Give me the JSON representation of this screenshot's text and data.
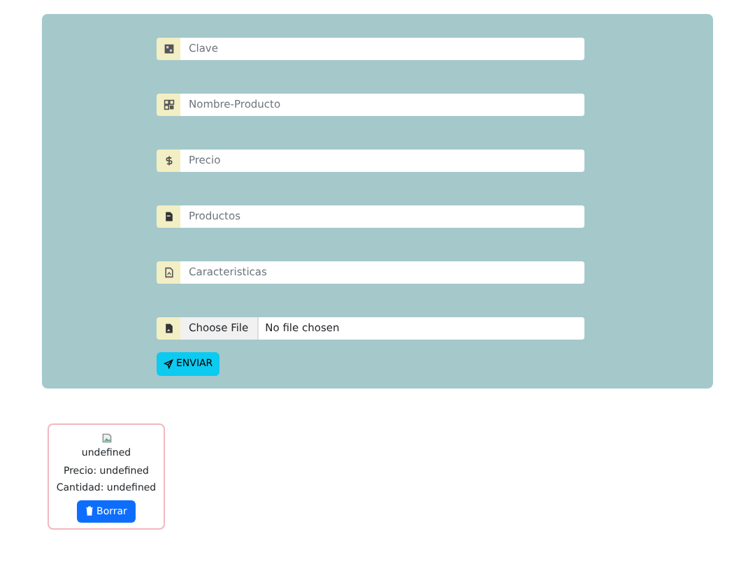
{
  "form": {
    "fields": [
      {
        "kind": "text",
        "placeholder": "Clave"
      },
      {
        "kind": "text",
        "placeholder": "Nombre-Producto"
      },
      {
        "kind": "text",
        "placeholder": "Precio"
      },
      {
        "kind": "text",
        "placeholder": "Productos"
      },
      {
        "kind": "text",
        "placeholder": "Caracteristicas"
      },
      {
        "kind": "file",
        "button": "Choose File",
        "value": "No file chosen"
      }
    ],
    "submit": "ENVIAR"
  },
  "cards": [
    {
      "name": "undefined",
      "price": "Precio: undefined",
      "quantity": "Cantidad: undefined",
      "button": "Borrar"
    }
  ]
}
